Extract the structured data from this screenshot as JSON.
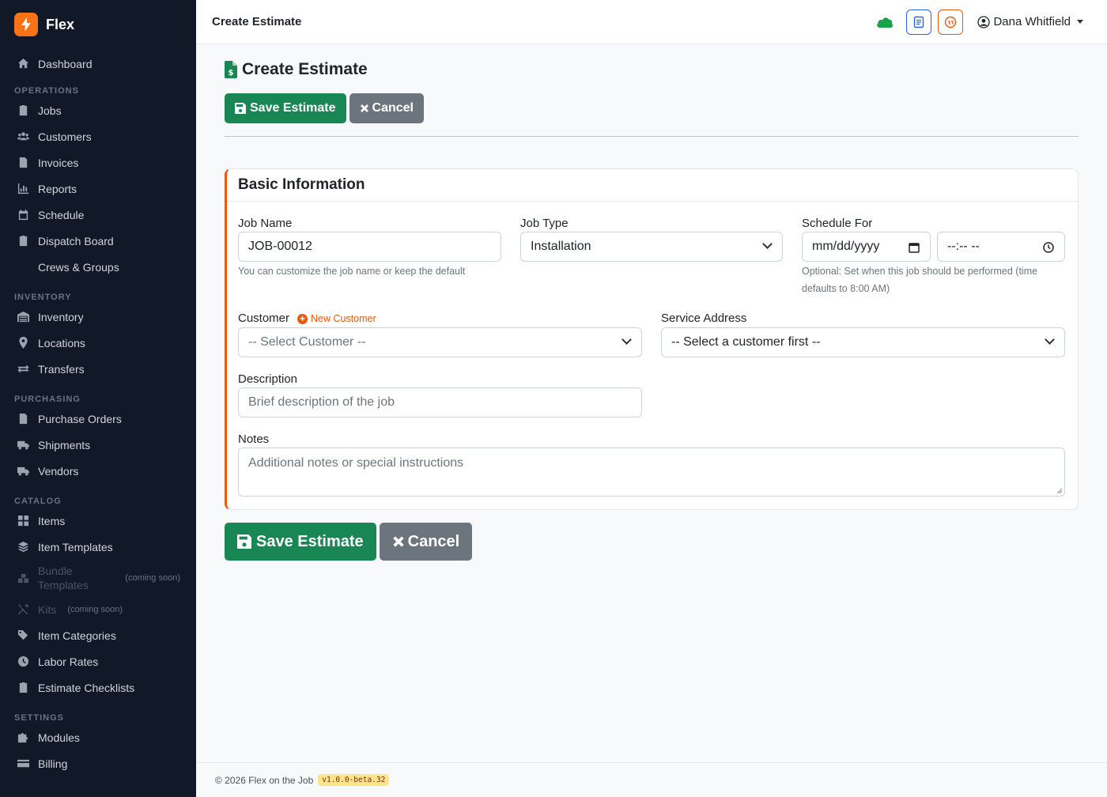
{
  "app": {
    "name": "Flex"
  },
  "sidebar": {
    "items": {
      "dashboard": "Dashboard",
      "jobs": "Jobs",
      "customers": "Customers",
      "invoices": "Invoices",
      "reports": "Reports",
      "schedule": "Schedule",
      "dispatch": "Dispatch Board",
      "crews": "Crews & Groups",
      "inventory": "Inventory",
      "locations": "Locations",
      "transfers": "Transfers",
      "purchase_orders": "Purchase Orders",
      "shipments": "Shipments",
      "vendors": "Vendors",
      "items": "Items",
      "item_templates": "Item Templates",
      "bundle_templates": "Bundle Templates",
      "kits": "Kits",
      "item_categories": "Item Categories",
      "labor_rates": "Labor Rates",
      "estimate_checklists": "Estimate Checklists",
      "modules": "Modules",
      "billing": "Billing"
    },
    "sections": {
      "operations": "OPERATIONS",
      "inventory": "INVENTORY",
      "purchasing": "PURCHASING",
      "catalog": "CATALOG",
      "settings": "SETTINGS"
    },
    "coming_soon": "(coming soon)"
  },
  "topbar": {
    "title": "Create Estimate",
    "user_name": "Dana Whitfield"
  },
  "page": {
    "title": "Create Estimate",
    "save_label": "Save Estimate",
    "cancel_label": "Cancel"
  },
  "form": {
    "section_title": "Basic Information",
    "job_name": {
      "label": "Job Name",
      "value": "JOB-00012",
      "help": "You can customize the job name or keep the default"
    },
    "job_type": {
      "label": "Job Type",
      "value": "Installation"
    },
    "schedule": {
      "label": "Schedule For",
      "date_placeholder": "mm/dd/yyyy",
      "time_placeholder": "--:-- --",
      "help_line1": "Optional: Set when this job should be performed (time",
      "help_line2": "defaults to 8:00 AM)"
    },
    "customer": {
      "label": "Customer",
      "new_label": "New Customer",
      "value": "-- Select Customer --"
    },
    "service_address": {
      "label": "Service Address",
      "value": "-- Select a customer first --"
    },
    "description": {
      "label": "Description",
      "placeholder": "Brief description of the job"
    },
    "notes": {
      "label": "Notes",
      "placeholder": "Additional notes or special instructions"
    }
  },
  "footer": {
    "copyright": "© 2026 Flex on the Job",
    "version": "v1.0.0-beta.32"
  },
  "colors": {
    "sidebar_bg": "#111827",
    "success": "#198754",
    "secondary": "#6c757d",
    "accent": "#ea580c"
  }
}
